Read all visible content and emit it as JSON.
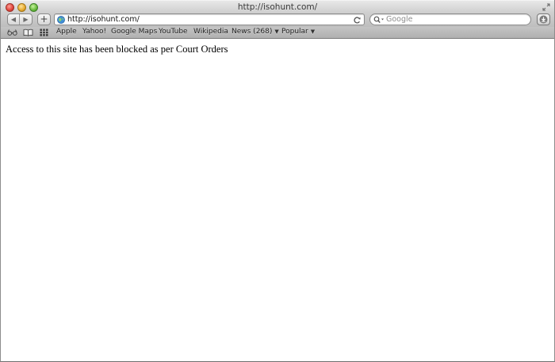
{
  "window": {
    "title": "http://isohunt.com/"
  },
  "toolbar": {
    "back_symbol": "◀",
    "forward_symbol": "▶",
    "add_symbol": "+",
    "address_value": "http://isohunt.com/",
    "search_placeholder": "Google"
  },
  "bookmarks": {
    "items": [
      {
        "label": "Apple"
      },
      {
        "label": "Yahoo!"
      },
      {
        "label": "Google Maps"
      },
      {
        "label": "YouTube"
      },
      {
        "label": "Wikipedia"
      },
      {
        "label": "News (268)"
      },
      {
        "label": "Popular"
      }
    ],
    "dropdown_caret": "▼"
  },
  "page": {
    "message": "Access to this site has been blocked as per Court Orders"
  },
  "icons": {
    "close": "traffic-close-icon",
    "minimize": "traffic-minimize-icon",
    "zoom": "traffic-zoom-icon",
    "reader": "reading-list-icon",
    "bookmarks": "bookmarks-book-icon",
    "top_sites": "top-sites-grid-icon",
    "globe": "globe-icon",
    "reload": "reload-icon",
    "search": "search-icon",
    "downloads": "downloads-icon"
  }
}
